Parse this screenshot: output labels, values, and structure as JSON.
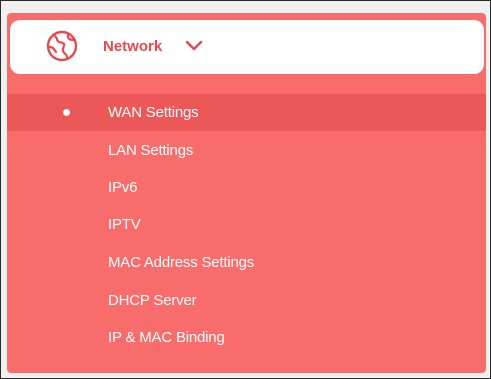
{
  "header": {
    "label": "Network",
    "icon": "globe-icon",
    "chevron": "chevron-down-icon",
    "accent_color": "#e8494b"
  },
  "menu": {
    "background_color": "#f86c6b",
    "active_background_color": "#ec5858",
    "text_color": "#ffffff",
    "items": [
      {
        "label": "WAN Settings",
        "active": true
      },
      {
        "label": "LAN Settings",
        "active": false
      },
      {
        "label": "IPv6",
        "active": false
      },
      {
        "label": "IPTV",
        "active": false
      },
      {
        "label": "MAC Address Settings",
        "active": false
      },
      {
        "label": "DHCP Server",
        "active": false
      },
      {
        "label": "IP & MAC Binding",
        "active": false
      }
    ]
  }
}
